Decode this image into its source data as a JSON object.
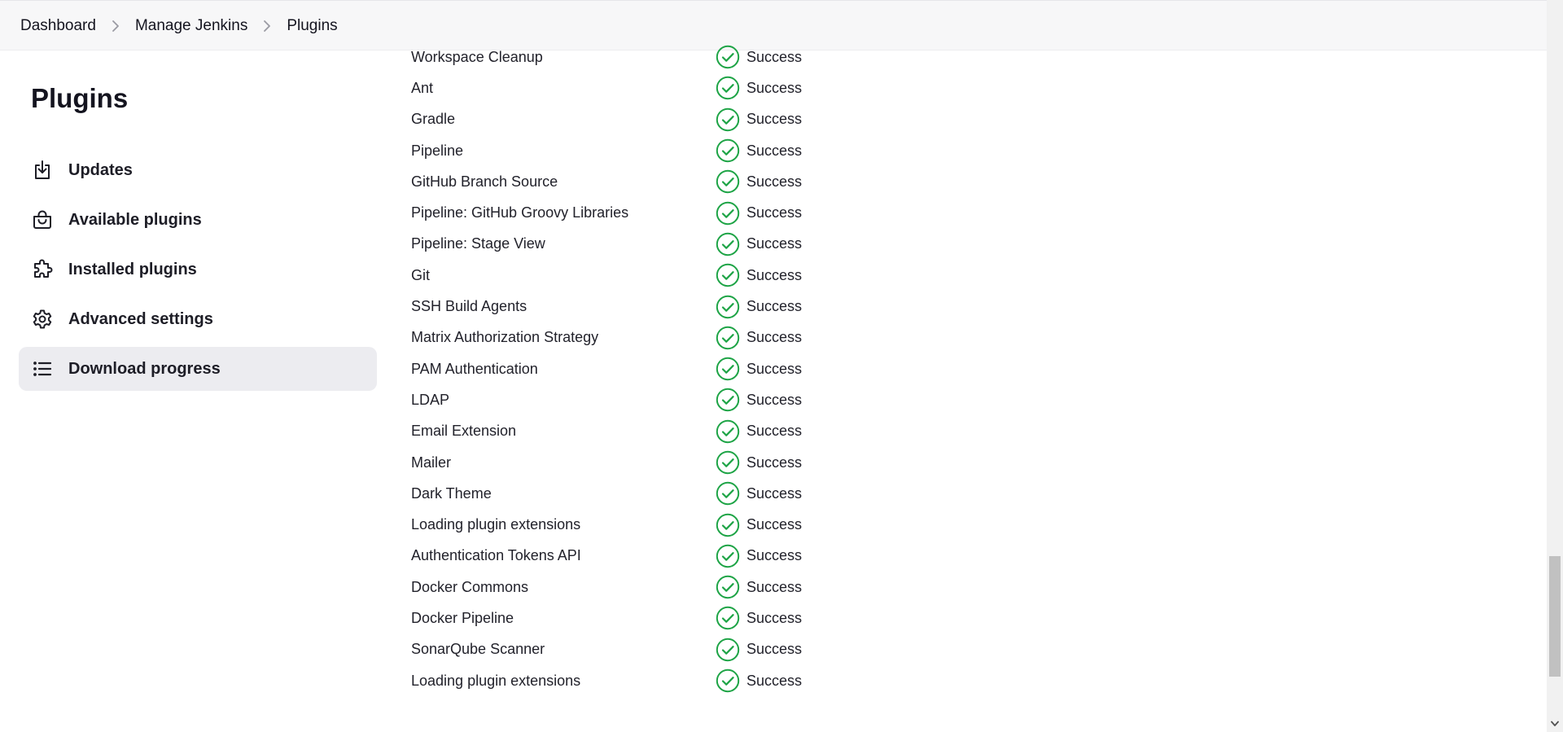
{
  "breadcrumb": {
    "items": [
      "Dashboard",
      "Manage Jenkins",
      "Plugins"
    ]
  },
  "sidebar": {
    "title": "Plugins",
    "items": [
      {
        "label": "Updates",
        "icon": "download-icon"
      },
      {
        "label": "Available plugins",
        "icon": "shopping-bag-icon"
      },
      {
        "label": "Installed plugins",
        "icon": "puzzle-icon"
      },
      {
        "label": "Advanced settings",
        "icon": "gear-icon"
      },
      {
        "label": "Download progress",
        "icon": "list-icon",
        "active": true
      }
    ]
  },
  "progress": {
    "rows": [
      {
        "name": "Workspace Cleanup",
        "status": "Success"
      },
      {
        "name": "Ant",
        "status": "Success"
      },
      {
        "name": "Gradle",
        "status": "Success"
      },
      {
        "name": "Pipeline",
        "status": "Success"
      },
      {
        "name": "GitHub Branch Source",
        "status": "Success"
      },
      {
        "name": "Pipeline: GitHub Groovy Libraries",
        "status": "Success"
      },
      {
        "name": "Pipeline: Stage View",
        "status": "Success"
      },
      {
        "name": "Git",
        "status": "Success"
      },
      {
        "name": "SSH Build Agents",
        "status": "Success"
      },
      {
        "name": "Matrix Authorization Strategy",
        "status": "Success"
      },
      {
        "name": "PAM Authentication",
        "status": "Success"
      },
      {
        "name": "LDAP",
        "status": "Success"
      },
      {
        "name": "Email Extension",
        "status": "Success"
      },
      {
        "name": "Mailer",
        "status": "Success"
      },
      {
        "name": "Dark Theme",
        "status": "Success"
      },
      {
        "name": "Loading plugin extensions",
        "status": "Success"
      },
      {
        "name": "Authentication Tokens API",
        "status": "Success"
      },
      {
        "name": "Docker Commons",
        "status": "Success"
      },
      {
        "name": "Docker Pipeline",
        "status": "Success"
      },
      {
        "name": "SonarQube Scanner",
        "status": "Success"
      },
      {
        "name": "Loading plugin extensions",
        "status": "Success"
      }
    ]
  },
  "colors": {
    "success": "#1ea446",
    "active_nav_bg": "#ececf0",
    "topbar_bg": "#f7f7f8"
  }
}
